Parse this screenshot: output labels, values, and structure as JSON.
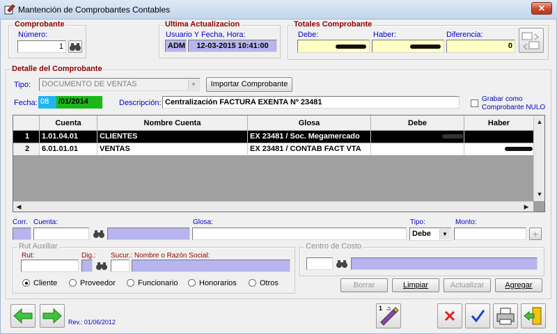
{
  "window": {
    "title": "Mantención de Comprobantes Contables",
    "close_glyph": "✕"
  },
  "comprobante": {
    "legend": "Comprobante",
    "numero_label": "Número:",
    "numero_value": "1"
  },
  "ultima": {
    "legend": "Ultima Actualizacion",
    "usuario_label": "Usuario Y  Fecha, Hora:",
    "usuario": "ADM",
    "fecha_hora": "12-03-2015 10:41:00"
  },
  "totales": {
    "legend": "Totales Comprobante",
    "debe_label": "Debe:",
    "haber_label": "Haber:",
    "diferencia_label": "Diferencia:",
    "diferencia_value": "0"
  },
  "detalle": {
    "legend": "Detalle del Comprobante",
    "tipo_label": "Tipo:",
    "tipo_value": "DOCUMENTO DE VENTAS",
    "importar_label": "Importar Comprobante",
    "fecha_label": "Fecha:",
    "fecha_day": "08",
    "fecha_rest": "/01/2014",
    "descripcion_label": "Descripción:",
    "descripcion_value": "Centralización FACTURA EXENTA Nº 23481",
    "grabar_label_1": "Grabar como",
    "grabar_label_2": "Comprobante NULO"
  },
  "grid": {
    "headers": [
      "",
      "Cuenta",
      "Nombre Cuenta",
      "Glosa",
      "Debe",
      "Haber"
    ],
    "rows": [
      {
        "n": "1",
        "cuenta": "1.01.04.01",
        "nombre": "CLIENTES",
        "glosa": "EX 23481 / Soc. Megamercado"
      },
      {
        "n": "2",
        "cuenta": "6.01.01.01",
        "nombre": "VENTAS",
        "glosa": "EX 23481 / CONTAB FACT VTA"
      }
    ]
  },
  "entry": {
    "corr_label": "Corr.",
    "cuenta_label": "Cuenta:",
    "glosa_label": "Glosa:",
    "tipo_label": "Tipo:",
    "tipo_value": "Debe",
    "monto_label": "Monto:",
    "add_glyph": "+"
  },
  "rut": {
    "legend": "Rut Auxiliar",
    "rut_label": "Rut:",
    "dig_label": "Dig.:",
    "sucur_label": "Sucur.: Nombre o Razón Social:",
    "options": [
      "Cliente",
      "Proveedor",
      "Funcionario",
      "Honorarios",
      "Otros"
    ],
    "selected": "Cliente"
  },
  "costo": {
    "legend": "Centro de Costo"
  },
  "actions": {
    "borrar": "Borrar",
    "limpiar": "Limpiar",
    "actualizar": "Actualizar",
    "agregar": "Agregar"
  },
  "footer": {
    "revision": "Rev.: 01/06/2012",
    "one_label": "1"
  },
  "colors": {
    "lavender": "#b7b4ee",
    "yellow": "#ffffc4",
    "date_green": "#19b819",
    "date_cyan": "#1fb6f0",
    "arrow_green": "#3cc43c"
  }
}
